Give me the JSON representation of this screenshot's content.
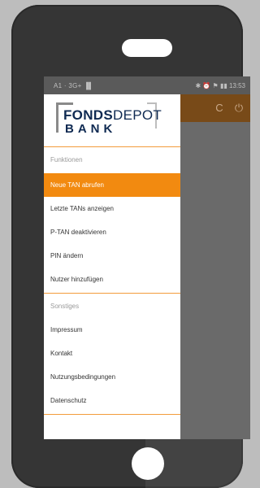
{
  "status_bar": {
    "left_text": "A1 · 3G+ ▐▌",
    "right_text": "✱ ⏰ ⚑ ▮▮ 13:53"
  },
  "app_bar": {
    "refresh_icon": "refresh-icon",
    "power_icon": "power-icon",
    "refresh_glyph": "C",
    "power_glyph": "⏻"
  },
  "logo": {
    "line1_bold": "FONDS",
    "line1_light": "DEPOT",
    "line2": "BANK"
  },
  "sections": {
    "functions_label": "Funktionen",
    "other_label": "Sonstiges"
  },
  "menu": {
    "functions": [
      {
        "label": "Neue TAN abrufen",
        "active": true
      },
      {
        "label": "Letzte TANs anzeigen",
        "active": false
      },
      {
        "label": "P-TAN deaktivieren",
        "active": false
      },
      {
        "label": "PIN ändern",
        "active": false
      },
      {
        "label": "Nutzer hinzufügen",
        "active": false
      }
    ],
    "other": [
      {
        "label": "Impressum"
      },
      {
        "label": "Kontakt"
      },
      {
        "label": "Nutzungsbedingungen"
      },
      {
        "label": "Datenschutz"
      }
    ]
  },
  "colors": {
    "accent": "#f28a10",
    "app_bar": "#784a18",
    "logo_navy": "#0f2a52"
  }
}
